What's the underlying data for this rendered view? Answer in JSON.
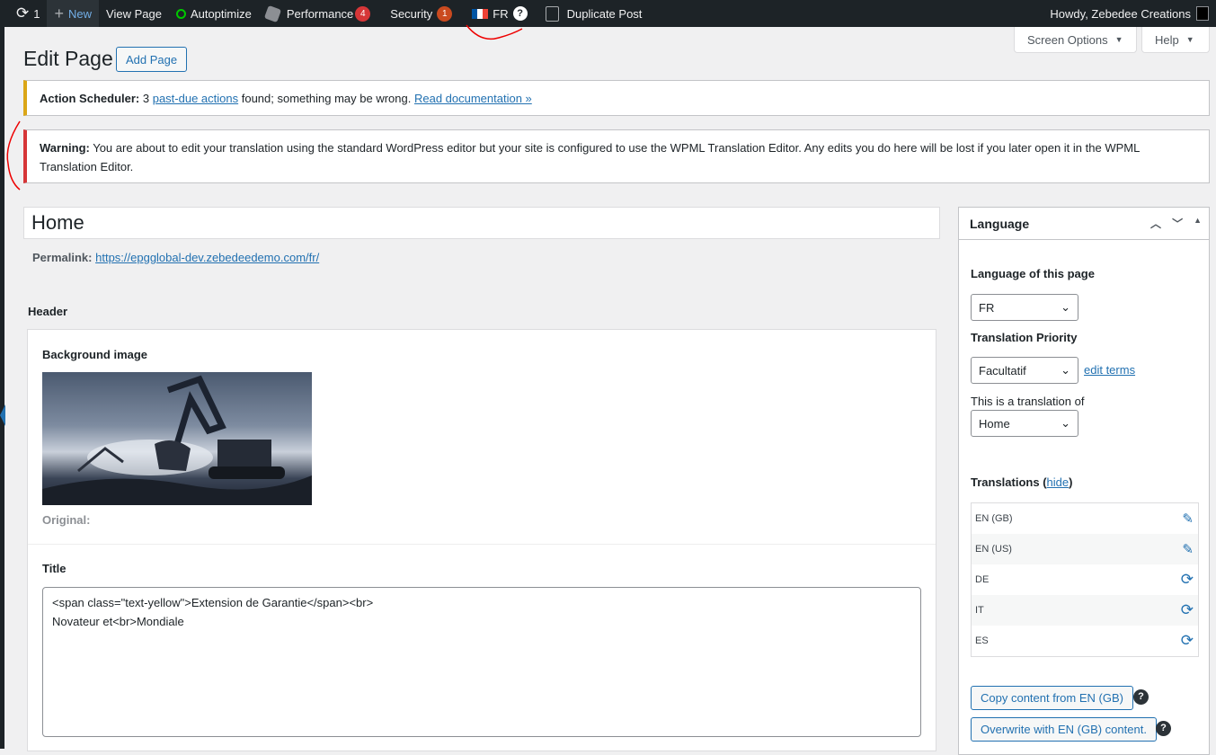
{
  "adminbar": {
    "updates_count": "1",
    "new": "New",
    "view_page": "View Page",
    "autoptimize": "Autoptimize",
    "performance": "Performance",
    "performance_badge": "4",
    "security": "Security",
    "security_badge": "1",
    "language": "FR",
    "duplicate_post": "Duplicate Post",
    "howdy": "Howdy, Zebedee Creations"
  },
  "tabs": {
    "screen_options": "Screen Options",
    "help": "Help"
  },
  "page": {
    "title": "Edit Page",
    "add_page": "Add Page"
  },
  "notices": {
    "action_scheduler": {
      "prefix": "Action Scheduler:",
      "text1": " 3 ",
      "link": "past-due actions",
      "text2": " found; something may be wrong. ",
      "doc_link": "Read documentation »"
    },
    "warning": {
      "prefix": "Warning:",
      "text": " You are about to edit your translation using the standard WordPress editor but your site is configured to use the WPML Translation Editor. Any edits you do here will be lost if you later open it in the WPML Translation Editor."
    }
  },
  "post": {
    "title": "Home",
    "permalink_label": "Permalink:",
    "permalink_url": "https://epgglobal-dev.zebedeedemo.com/fr/"
  },
  "acf": {
    "group_label": "Header",
    "bg_label": "Background image",
    "original_label": "Original:",
    "title_label": "Title",
    "title_value": "<span class=\"text-yellow\">Extension de Garantie</span><br>\nNovateur et<br>Mondiale"
  },
  "language_box": {
    "title": "Language",
    "lang_of_page_label": "Language of this page",
    "lang_value": "FR",
    "priority_label": "Translation Priority",
    "priority_value": "Facultatif",
    "edit_terms": "edit terms",
    "translation_of_label": "This is a translation of",
    "translation_of_value": "Home",
    "translations_label": "Translations (",
    "hide": "hide",
    "translations_close": ")",
    "translations": [
      {
        "lang": "EN (GB)",
        "icon": "pencil"
      },
      {
        "lang": "EN (US)",
        "icon": "pencil"
      },
      {
        "lang": "DE",
        "icon": "refresh"
      },
      {
        "lang": "IT",
        "icon": "refresh"
      },
      {
        "lang": "ES",
        "icon": "refresh"
      }
    ],
    "copy_btn": "Copy content from EN (GB)",
    "overwrite_btn": "Overwrite with EN (GB) content.",
    "help_q": "?"
  }
}
